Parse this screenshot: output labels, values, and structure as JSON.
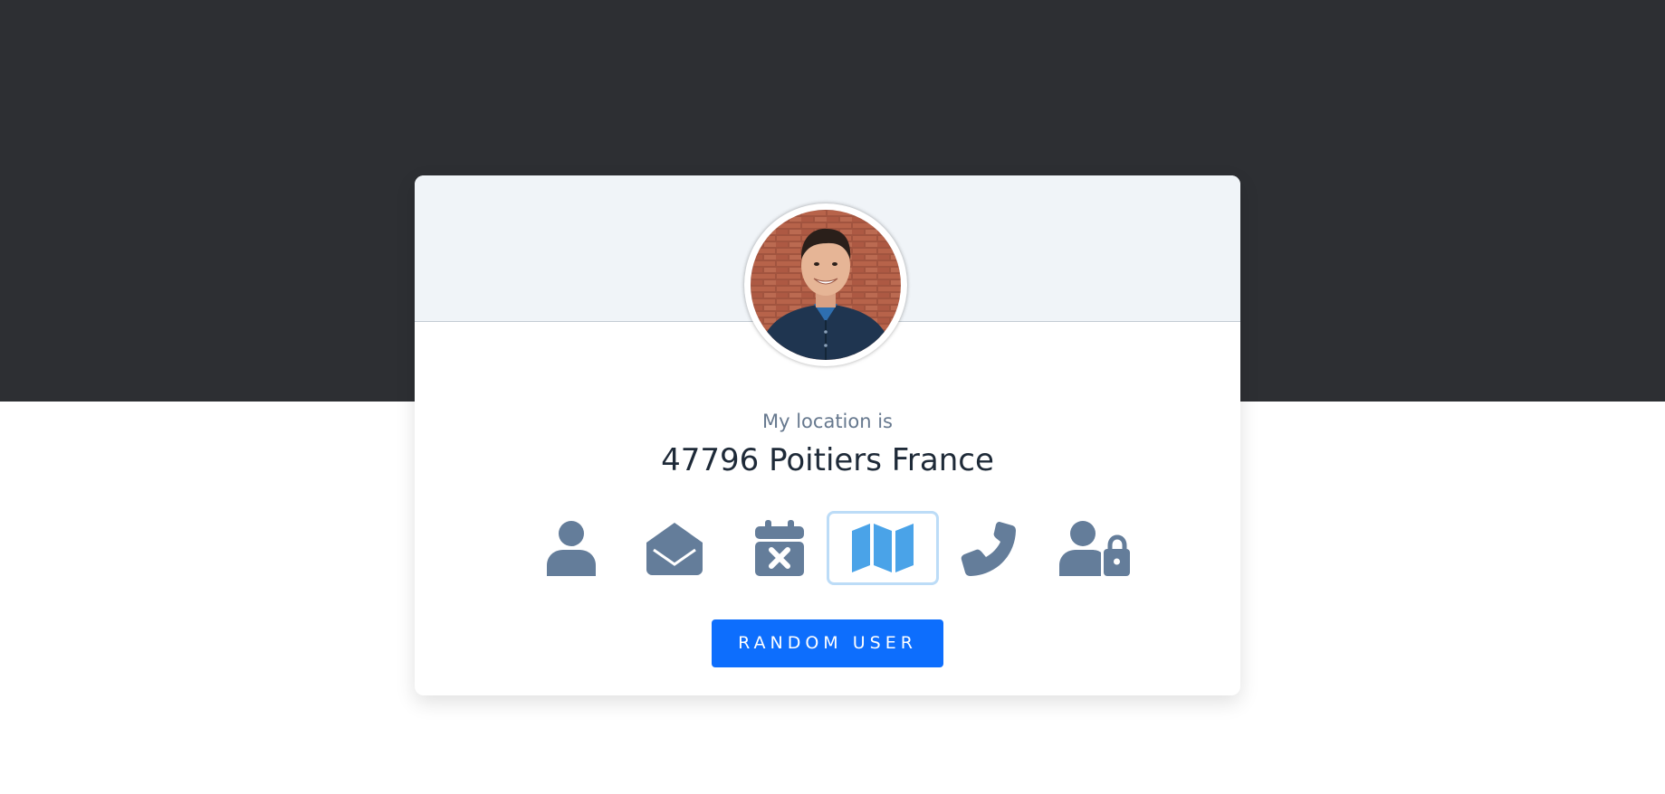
{
  "profile": {
    "label": "My location is",
    "value": "47796 Poitiers France"
  },
  "icons": [
    {
      "name": "user-icon",
      "active": false
    },
    {
      "name": "envelope-open-icon",
      "active": false
    },
    {
      "name": "calendar-x-icon",
      "active": false
    },
    {
      "name": "map-icon",
      "active": true
    },
    {
      "name": "phone-icon",
      "active": false
    },
    {
      "name": "user-lock-icon",
      "active": false
    }
  ],
  "button": {
    "label": "RANDOM USER"
  },
  "colors": {
    "icon": "#647d9a",
    "active_icon": "#4aa3e8",
    "accent": "#0d6efd",
    "dark_band": "#2d2f33"
  }
}
